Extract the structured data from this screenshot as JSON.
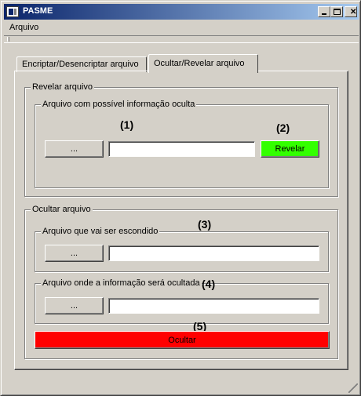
{
  "window": {
    "title": "PASME"
  },
  "menu": {
    "items": [
      "Arquivo"
    ]
  },
  "tabs": [
    {
      "label": "Encriptar/Desencriptar arquivo",
      "active": false
    },
    {
      "label": "Ocultar/Revelar arquivo",
      "active": true
    }
  ],
  "reveal": {
    "group_label": "Revelar arquivo",
    "inner_group_label": "Arquivo com possível informação oculta",
    "browse_label": "...",
    "file_value": "",
    "reveal_button_label": "Revelar",
    "marker_1": "(1)",
    "marker_2": "(2)"
  },
  "hide": {
    "group_label": "Ocultar arquivo",
    "file_group_label": "Arquivo que vai ser escondido",
    "file_browse_label": "...",
    "file_value": "",
    "marker_3": "(3)",
    "carrier_group_label": "Arquivo onde a informação será ocultada",
    "carrier_browse_label": "...",
    "carrier_value": "",
    "marker_4": "(4)",
    "hide_button_label": "Ocultar",
    "marker_5": "(5)"
  },
  "colors": {
    "reveal_button": "#33ff00",
    "hide_button": "#ff0000",
    "titlebar_start": "#0a246a",
    "titlebar_end": "#a6caf0",
    "window_face": "#d4d0c8"
  },
  "icons": {
    "app": "app-icon",
    "minimize": "minimize-icon",
    "maximize": "maximize-icon",
    "close": "close-icon",
    "resize": "resize-grip-icon"
  }
}
